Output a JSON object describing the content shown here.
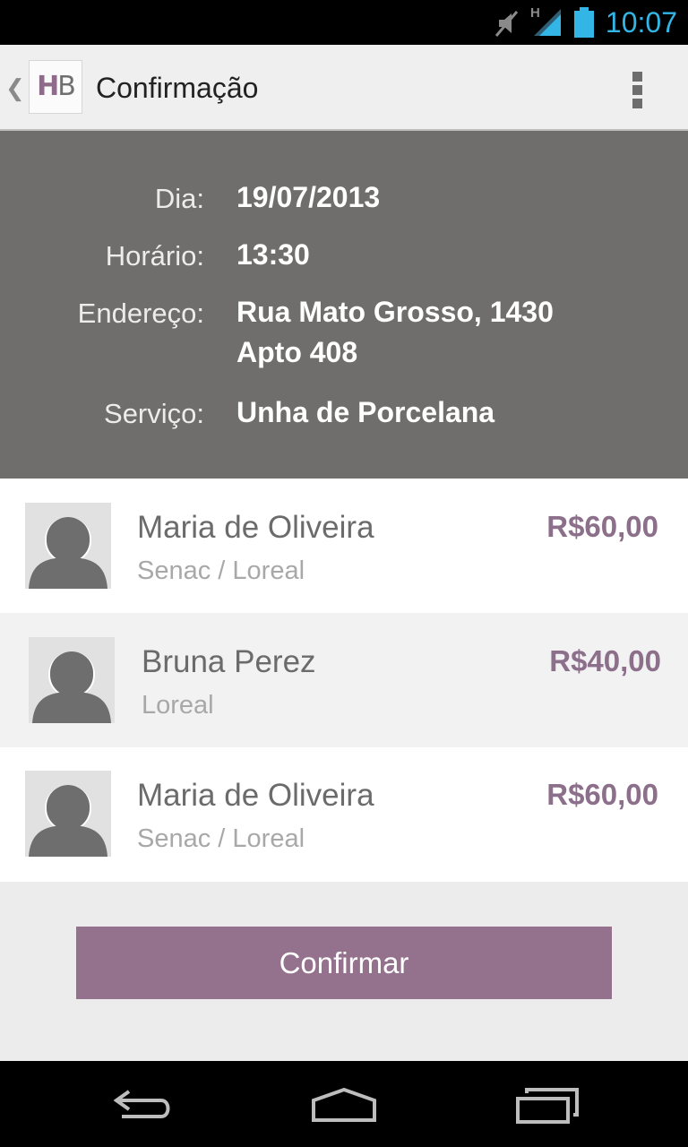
{
  "status_bar": {
    "time": "10:07",
    "time_color": "#33b5e5",
    "network_label": "H",
    "icons": [
      "mute-icon",
      "signal-icon",
      "battery-icon"
    ]
  },
  "action_bar": {
    "logo_h": "H",
    "logo_b": "B",
    "title": "Confirmação",
    "icons": [
      "up-chevron-icon",
      "overflow-menu-icon"
    ]
  },
  "details": {
    "day_label": "Dia:",
    "day_value": "19/07/2013",
    "time_label": "Horário:",
    "time_value": "13:30",
    "address_label": "Endereço:",
    "address_line1": "Rua Mato Grosso, 1430",
    "address_line2": "Apto 408",
    "service_label": "Serviço:",
    "service_value": "Unha de Porcelana"
  },
  "professionals": [
    {
      "name": "Maria de Oliveira",
      "subtitle": "Senac / Loreal",
      "price": "R$60,00"
    },
    {
      "name": "Bruna Perez",
      "subtitle": "Loreal",
      "price": "R$40,00"
    },
    {
      "name": "Maria de Oliveira",
      "subtitle": "Senac / Loreal",
      "price": "R$60,00"
    }
  ],
  "confirm_label": "Confirmar",
  "colors": {
    "accent": "#94728e",
    "price": "#8c6f8a",
    "details_bg": "#6f6e6c"
  },
  "nav_bar": {
    "icons": [
      "back-icon",
      "home-icon",
      "recent-apps-icon"
    ]
  }
}
